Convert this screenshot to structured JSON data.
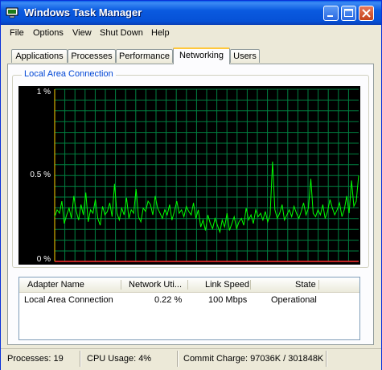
{
  "window": {
    "title": "Windows Task Manager"
  },
  "menu": [
    "File",
    "Options",
    "View",
    "Shut Down",
    "Help"
  ],
  "tabs": [
    "Applications",
    "Processes",
    "Performance",
    "Networking",
    "Users"
  ],
  "active_tab": "Networking",
  "group": {
    "label": "Local Area Connection"
  },
  "chart_data": {
    "type": "line",
    "title": "Local Area Connection",
    "ylim": [
      0,
      1
    ],
    "y_ticks": [
      "1 %",
      "0.5 %",
      "0 %"
    ],
    "grid": true,
    "series": [
      {
        "color": "#00ff00",
        "values": [
          0.26,
          0.3,
          0.28,
          0.35,
          0.22,
          0.27,
          0.31,
          0.25,
          0.38,
          0.29,
          0.24,
          0.33,
          0.27,
          0.4,
          0.23,
          0.3,
          0.28,
          0.36,
          0.25,
          0.21,
          0.32,
          0.27,
          0.29,
          0.34,
          0.26,
          0.45,
          0.28,
          0.24,
          0.31,
          0.27,
          0.37,
          0.25,
          0.3,
          0.28,
          0.42,
          0.26,
          0.23,
          0.31,
          0.29,
          0.35,
          0.33,
          0.27,
          0.38,
          0.31,
          0.28,
          0.25,
          0.3,
          0.27,
          0.33,
          0.24,
          0.29,
          0.35,
          0.28,
          0.3,
          0.26,
          0.32,
          0.29,
          0.27,
          0.34,
          0.25,
          0.3,
          0.2,
          0.24,
          0.18,
          0.27,
          0.22,
          0.19,
          0.25,
          0.21,
          0.17,
          0.24,
          0.2,
          0.28,
          0.18,
          0.22,
          0.26,
          0.19,
          0.23,
          0.25,
          0.21,
          0.31,
          0.24,
          0.27,
          0.22,
          0.3,
          0.26,
          0.28,
          0.24,
          0.29,
          0.23,
          0.27,
          0.58,
          0.3,
          0.25,
          0.28,
          0.33,
          0.24,
          0.27,
          0.3,
          0.26,
          0.32,
          0.28,
          0.25,
          0.29,
          0.34,
          0.27,
          0.31,
          0.48,
          0.28,
          0.26,
          0.3,
          0.27,
          0.33,
          0.25,
          0.29,
          0.36,
          0.31,
          0.27,
          0.3,
          0.34,
          0.26,
          0.3,
          0.38,
          0.28,
          0.47,
          0.32,
          0.35,
          0.5
        ]
      }
    ]
  },
  "list": {
    "columns": [
      "Adapter Name",
      "Network Uti...",
      "Link Speed",
      "State"
    ],
    "rows": [
      {
        "adapter": "Local Area Connection",
        "utilization": "0.22 %",
        "speed": "100 Mbps",
        "state": "Operational"
      }
    ]
  },
  "status": {
    "processes": "Processes: 19",
    "cpu": "CPU Usage: 4%",
    "commit": "Commit Charge: 97036K / 301848K"
  }
}
